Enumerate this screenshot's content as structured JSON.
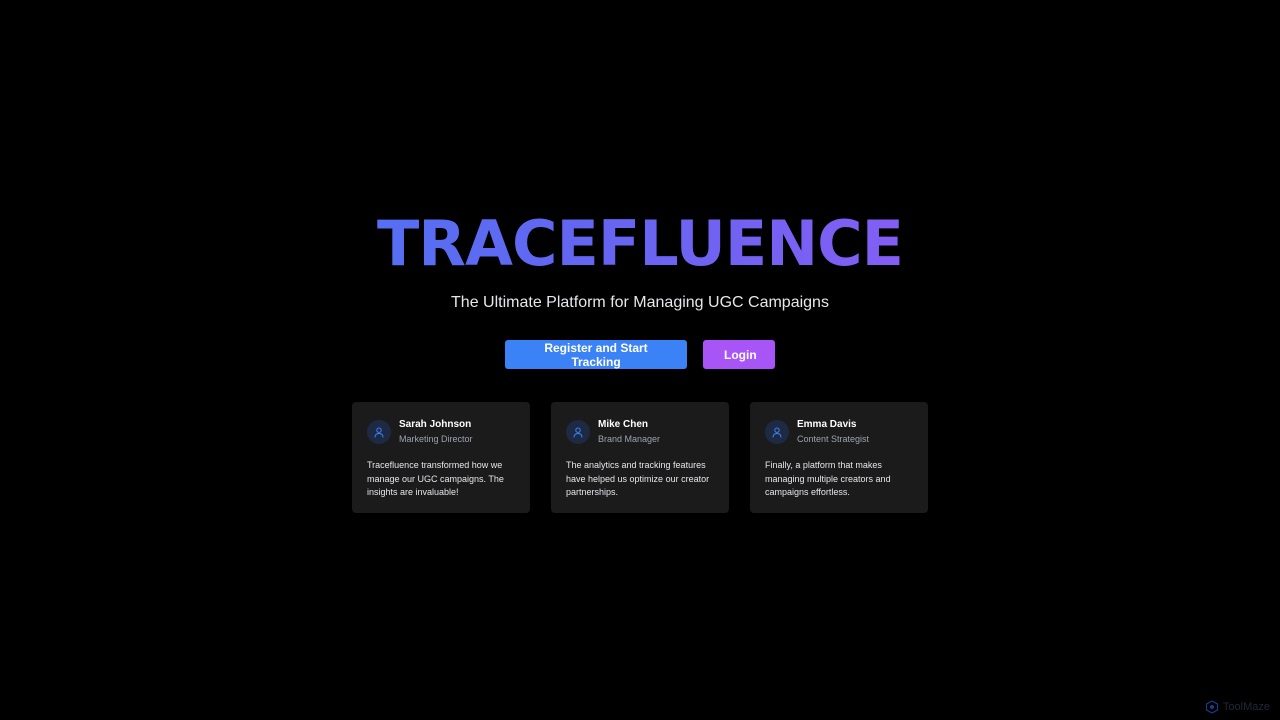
{
  "hero": {
    "title": "TRACEFLUENCE",
    "subtitle": "The Ultimate Platform for Managing UGC Campaigns"
  },
  "actions": {
    "register_label": "Register and Start Tracking",
    "login_label": "Login"
  },
  "testimonials": [
    {
      "name": "Sarah Johnson",
      "role": "Marketing Director",
      "quote": "Tracefluence transformed how we manage our UGC campaigns. The insights are invaluable!",
      "icon": "user-icon"
    },
    {
      "name": "Mike Chen",
      "role": "Brand Manager",
      "quote": "The analytics and tracking features have helped us optimize our creator partnerships.",
      "icon": "user-icon"
    },
    {
      "name": "Emma Davis",
      "role": "Content Strategist",
      "quote": "Finally, a platform that makes managing multiple creators and campaigns effortless.",
      "icon": "user-icon"
    }
  ],
  "watermark": {
    "text": "ToolMaze",
    "icon": "toolmaze-logo-icon"
  },
  "colors": {
    "background": "#000000",
    "gradient_start": "#3b82f6",
    "gradient_end": "#a855f7",
    "register_button": "#3b82f6",
    "login_button": "#a855f7",
    "card_background": "#1b1b1b"
  }
}
